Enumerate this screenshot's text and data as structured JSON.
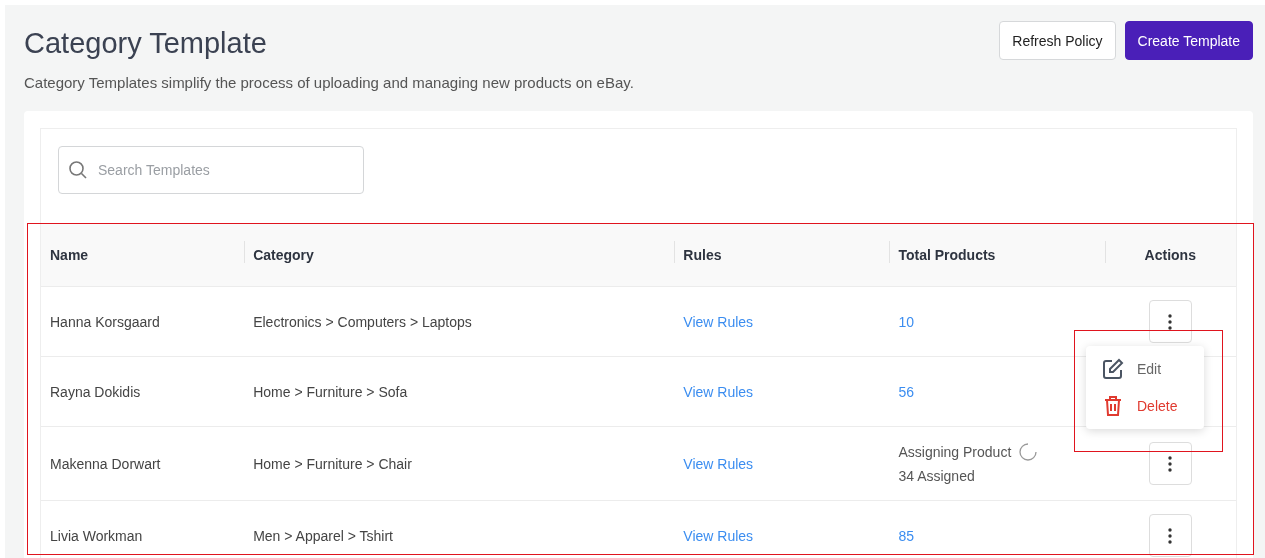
{
  "page": {
    "title": "Category Template",
    "description": "Category Templates simplify the process of uploading and managing new products on eBay.",
    "buttons": [
      {
        "label": "Refresh Policy",
        "kind": "secondary"
      },
      {
        "label": "Create Template",
        "kind": "primary"
      }
    ]
  },
  "search": {
    "placeholder": "Search Templates"
  },
  "table": {
    "columns": [
      "Name",
      "Category",
      "Rules",
      "Total Products",
      "Actions"
    ],
    "rows": [
      {
        "name": "Hanna Korsgaard",
        "category": "Electronics > Computers > Laptops",
        "rules": "View Rules",
        "total": {
          "kind": "count",
          "text": "10"
        },
        "menu_open": true
      },
      {
        "name": "Rayna Dokidis",
        "category": "Home > Furniture > Sofa",
        "rules": "View Rules",
        "total": {
          "kind": "count",
          "text": "56"
        },
        "menu_open": false
      },
      {
        "name": "Makenna Dorwart",
        "category": "Home > Furniture > Chair",
        "rules": "View Rules",
        "total": {
          "kind": "progress",
          "text": "Assigning Product",
          "detail": "34 Assigned"
        },
        "menu_open": false
      },
      {
        "name": "Livia Workman",
        "category": "Men > Apparel > Tshirt",
        "rules": "View Rules",
        "total": {
          "kind": "count",
          "text": "85"
        },
        "menu_open": false
      }
    ]
  },
  "action_menu": {
    "items": [
      {
        "label": "Edit",
        "kind": "edit"
      },
      {
        "label": "Delete",
        "kind": "delete"
      }
    ]
  }
}
